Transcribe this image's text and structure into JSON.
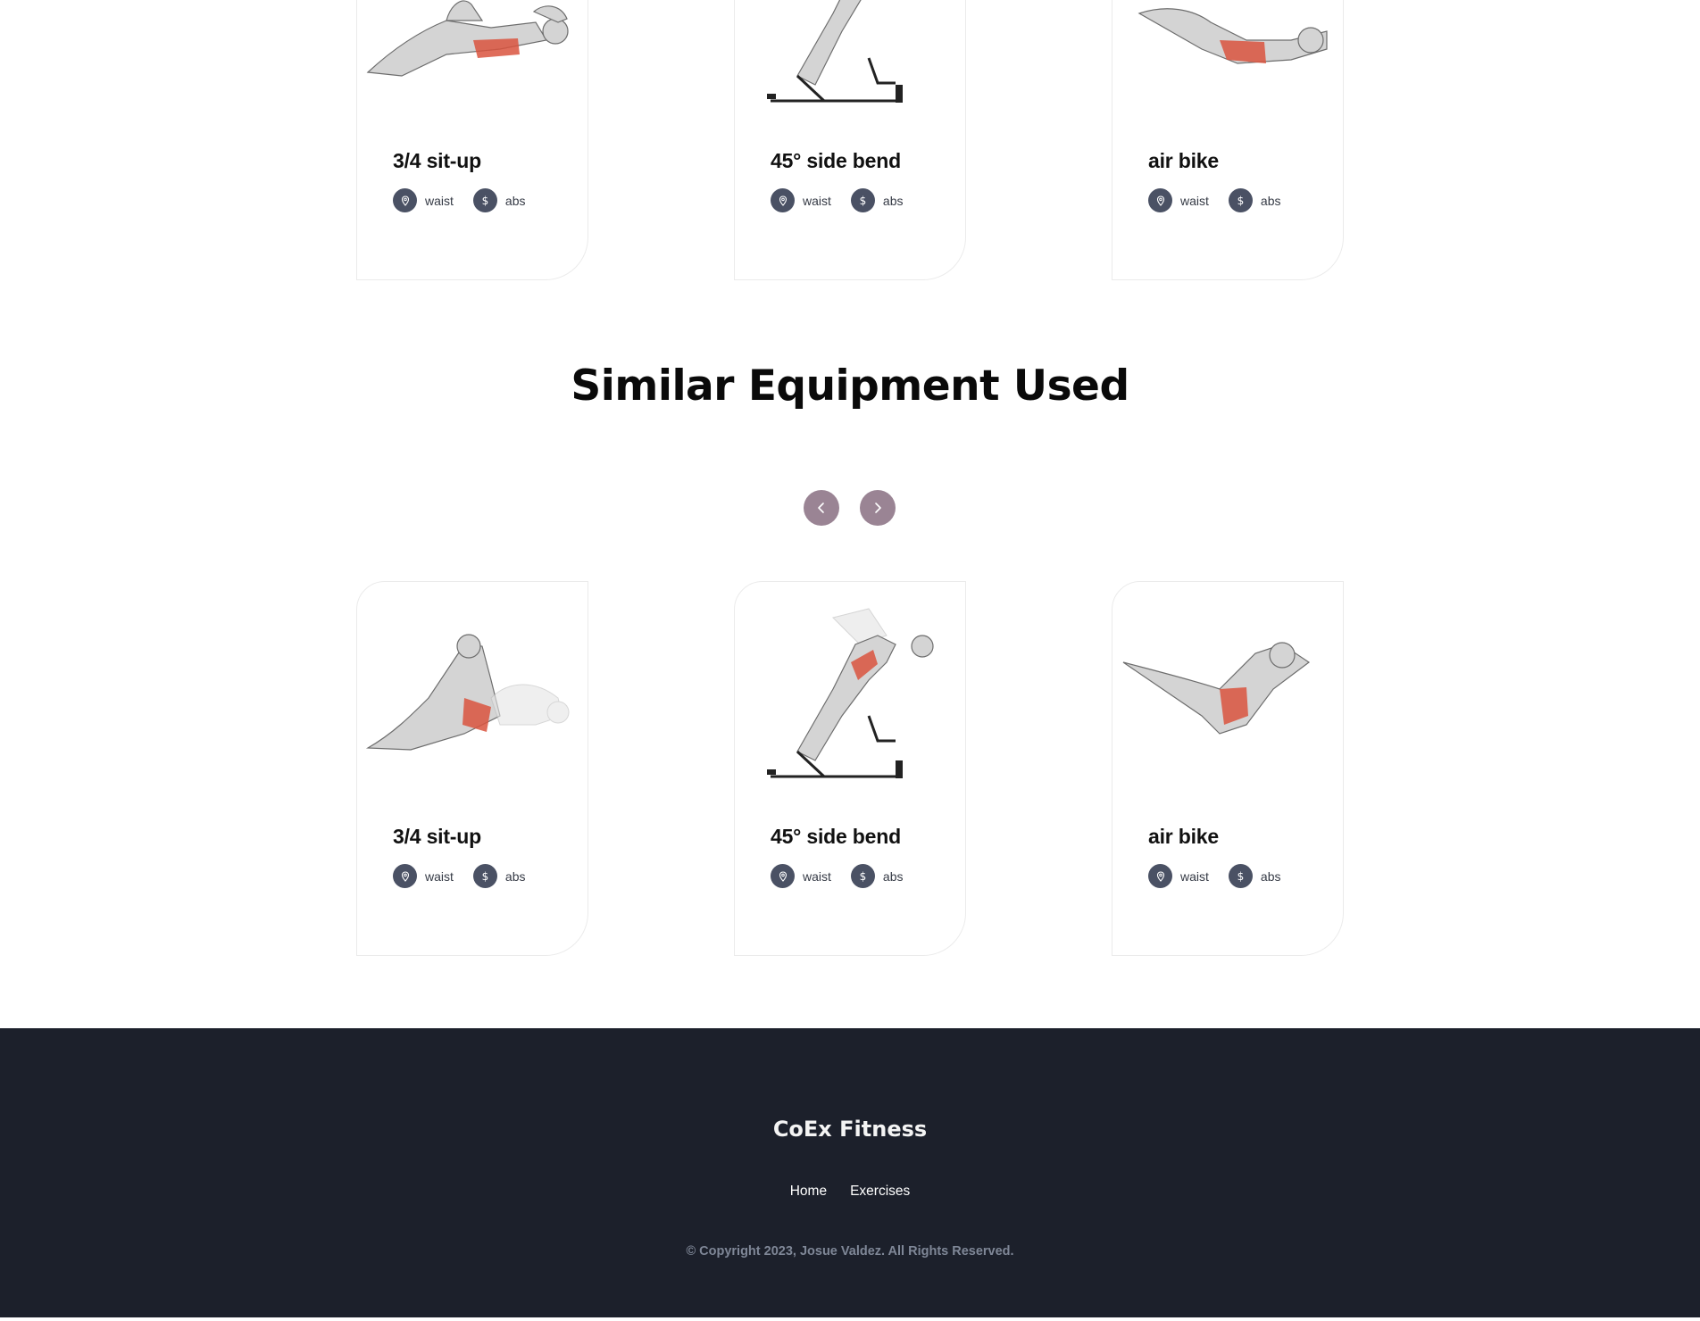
{
  "top_row": {
    "cards": [
      {
        "title": "3/4 sit-up",
        "tags": [
          {
            "icon": "location-pin-icon",
            "label": "waist"
          },
          {
            "icon": "dollar-icon",
            "label": "abs"
          }
        ]
      },
      {
        "title": "45° side bend",
        "tags": [
          {
            "icon": "location-pin-icon",
            "label": "waist"
          },
          {
            "icon": "dollar-icon",
            "label": "abs"
          }
        ]
      },
      {
        "title": "air bike",
        "tags": [
          {
            "icon": "location-pin-icon",
            "label": "waist"
          },
          {
            "icon": "dollar-icon",
            "label": "abs"
          }
        ]
      }
    ]
  },
  "similar_section": {
    "title": "Similar Equipment Used",
    "prev_icon": "chevron-left-icon",
    "next_icon": "chevron-right-icon",
    "cards": [
      {
        "title": "3/4 sit-up",
        "tags": [
          {
            "icon": "location-pin-icon",
            "label": "waist"
          },
          {
            "icon": "dollar-icon",
            "label": "abs"
          }
        ]
      },
      {
        "title": "45° side bend",
        "tags": [
          {
            "icon": "location-pin-icon",
            "label": "waist"
          },
          {
            "icon": "dollar-icon",
            "label": "abs"
          }
        ]
      },
      {
        "title": "air bike",
        "tags": [
          {
            "icon": "location-pin-icon",
            "label": "waist"
          },
          {
            "icon": "dollar-icon",
            "label": "abs"
          }
        ]
      }
    ]
  },
  "footer": {
    "brand": "CoEx Fitness",
    "links": [
      "Home",
      "Exercises"
    ],
    "copyright": "© Copyright 2023, Josue Valdez. All Rights Reserved."
  },
  "colors": {
    "tag_icon_bg": "#4a5164",
    "nav_arrow_bg": "#9a8494",
    "footer_bg": "#1c202b",
    "muscle_highlight": "#d9543e"
  }
}
